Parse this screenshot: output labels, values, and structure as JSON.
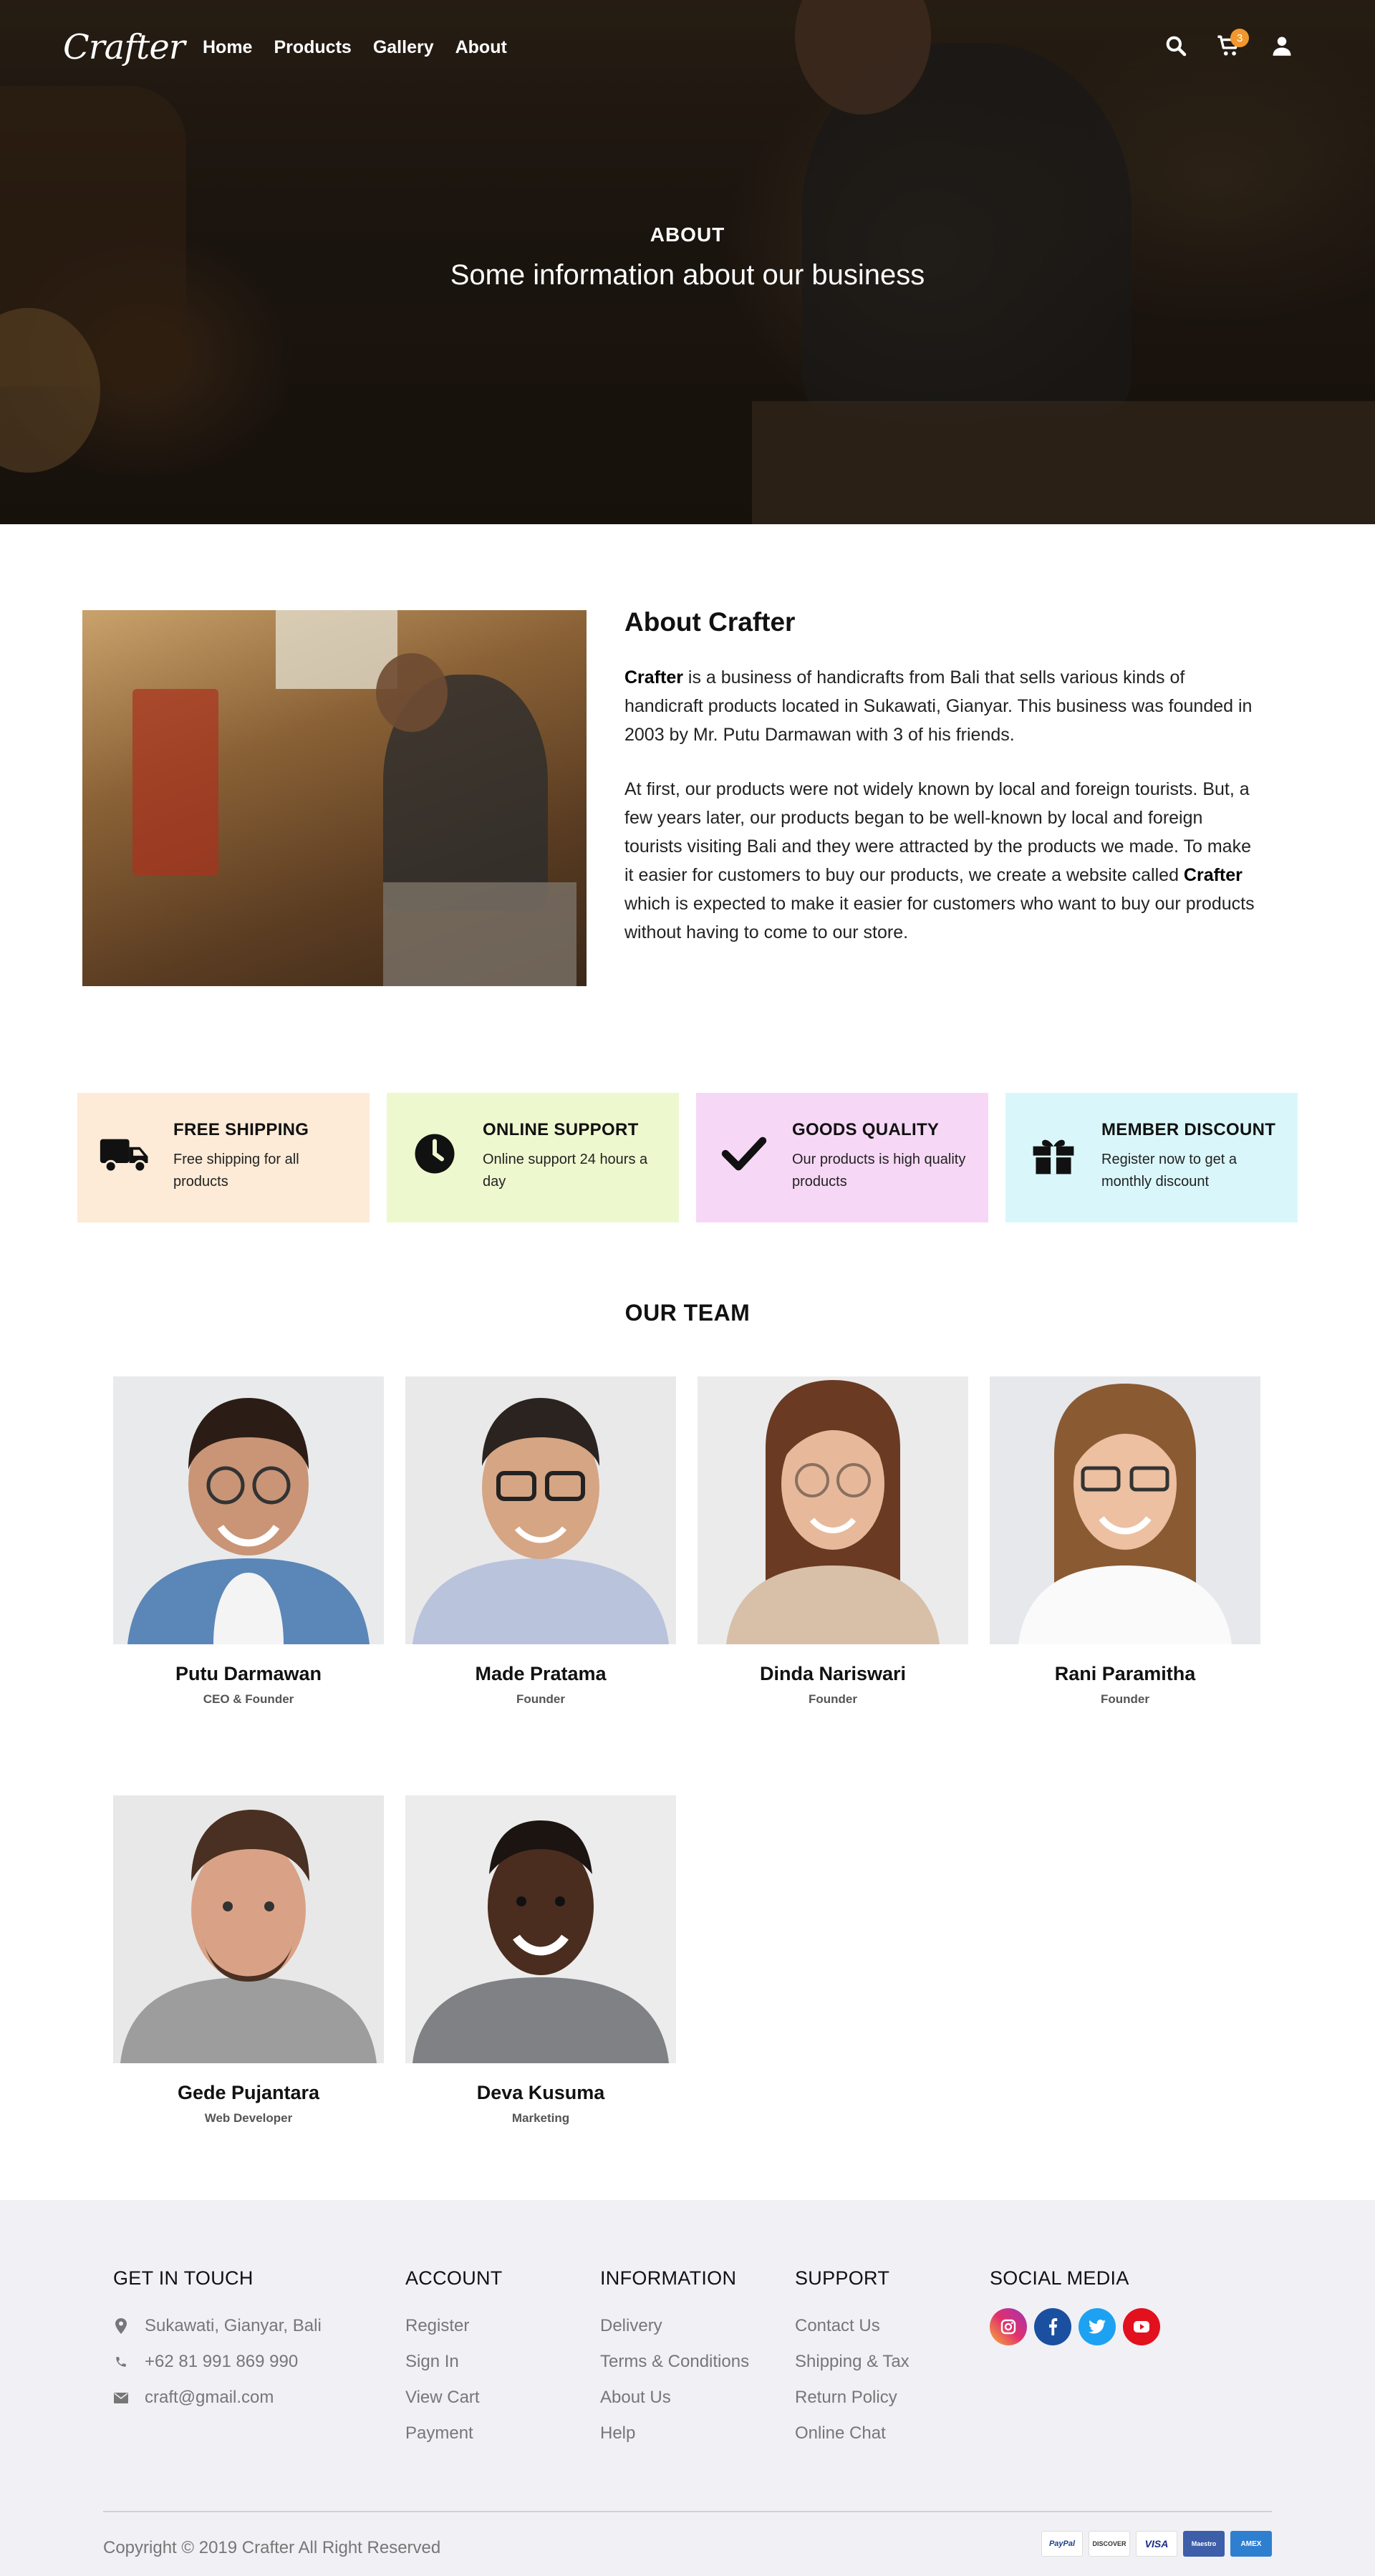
{
  "nav": {
    "logo": "Crafter",
    "links": [
      "Home",
      "Products",
      "Gallery",
      "About"
    ],
    "cart_count": "3"
  },
  "hero": {
    "kicker": "ABOUT",
    "title": "Some information about our business"
  },
  "about": {
    "title": "About Crafter",
    "p1_bold": "Crafter",
    "p1_rest": " is a business of handicrafts from Bali that sells various kinds of handicraft products located in Sukawati, Gianyar. This business was founded in 2003 by Mr. Putu Darmawan with 3 of his friends.",
    "p2_start": "At first, our products were not widely known by local and foreign tourists. But, a few years later, our products began to be well-known by local and foreign tourists visiting Bali and they were attracted by the products we made. To make it easier for customers to buy our products, we create a website called ",
    "p2_bold": "Crafter",
    "p2_end": " which is expected to make it easier for customers who want to buy our products without having to come to our store."
  },
  "features": [
    {
      "title": "FREE SHIPPING",
      "desc": "Free shipping for all products",
      "icon": "truck-icon",
      "bg": "#fdebd7"
    },
    {
      "title": "ONLINE SUPPORT",
      "desc": "Online support 24 hours a day",
      "icon": "clock-icon",
      "bg": "#eef8cf"
    },
    {
      "title": "GOODS QUALITY",
      "desc": "Our products is high quality products",
      "icon": "check-icon",
      "bg": "#f6d8f6"
    },
    {
      "title": "MEMBER DISCOUNT",
      "desc": "Register now to get a monthly discount",
      "icon": "gift-icon",
      "bg": "#d9f7fa"
    }
  ],
  "team": {
    "heading": "OUR TEAM",
    "members": [
      {
        "name": "Putu Darmawan",
        "role": "CEO & Founder"
      },
      {
        "name": "Made Pratama",
        "role": "Founder"
      },
      {
        "name": "Dinda Nariswari",
        "role": "Founder"
      },
      {
        "name": "Rani Paramitha",
        "role": "Founder"
      },
      {
        "name": "Gede Pujantara",
        "role": "Web Developer"
      },
      {
        "name": "Deva Kusuma",
        "role": "Marketing"
      }
    ]
  },
  "footer": {
    "contact": {
      "title": "GET IN TOUCH",
      "address": "Sukawati, Gianyar, Bali",
      "phone": "+62 81 991 869 990",
      "email": "craft@gmail.com"
    },
    "account": {
      "title": "ACCOUNT",
      "links": [
        "Register",
        "Sign In",
        "View Cart",
        "Payment"
      ]
    },
    "information": {
      "title": "INFORMATION",
      "links": [
        "Delivery",
        "Terms & Conditions",
        "About Us",
        "Help"
      ]
    },
    "support": {
      "title": "SUPPORT",
      "links": [
        "Contact Us",
        "Shipping & Tax",
        "Return Policy",
        "Online Chat"
      ]
    },
    "social": {
      "title": "SOCIAL MEDIA",
      "icons": [
        "instagram-icon",
        "facebook-icon",
        "twitter-icon",
        "youtube-icon"
      ]
    },
    "copyright": "Copyright © 2019 Crafter All Right Reserved",
    "payments": [
      "PayPal",
      "DISCOVER",
      "VISA",
      "Maestro",
      "AMEX"
    ]
  }
}
